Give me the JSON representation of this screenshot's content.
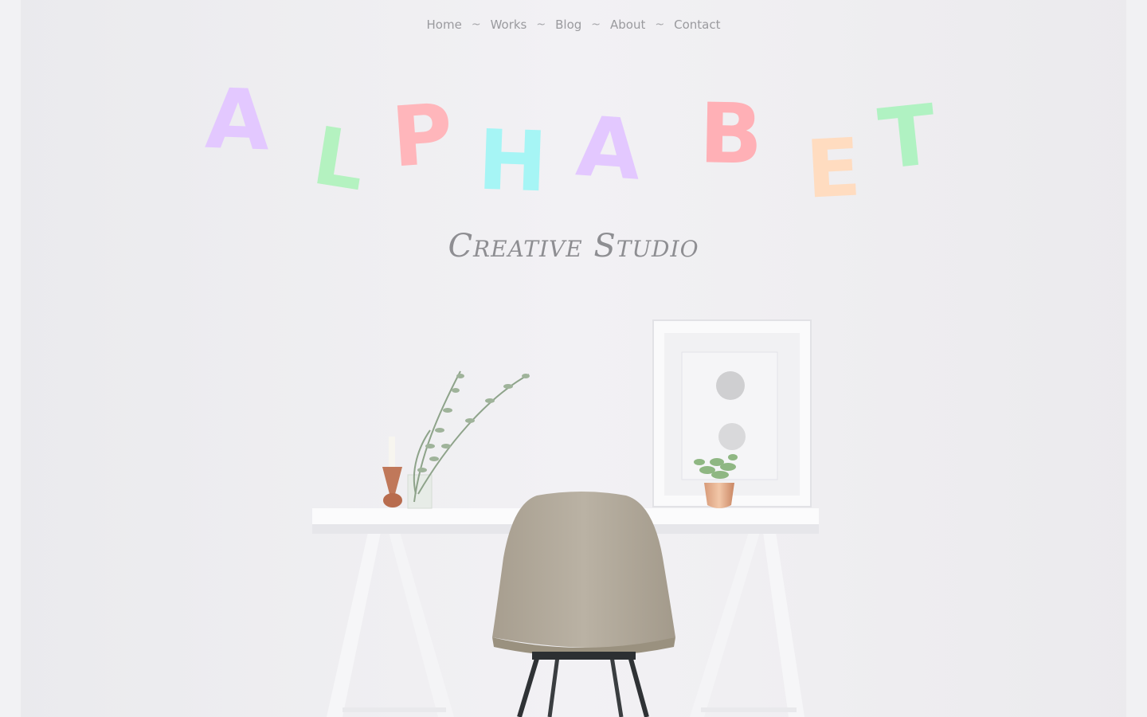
{
  "nav": {
    "items": [
      "Home",
      "Works",
      "Blog",
      "About",
      "Contact"
    ],
    "separator": "~"
  },
  "hero": {
    "letters": [
      {
        "char": "A",
        "color": "#e3c8ff"
      },
      {
        "char": "L",
        "color": "#b4f2c0"
      },
      {
        "char": "P",
        "color": "#ffb6bb"
      },
      {
        "char": "H",
        "color": "#a6f5f5"
      },
      {
        "char": "A",
        "color": "#e3c8ff"
      },
      {
        "char": "B",
        "color": "#ffb0b6"
      },
      {
        "char": "E",
        "color": "#ffdcc0"
      },
      {
        "char": "T",
        "color": "#b0f2c2"
      }
    ],
    "subtitle": "Creative Studio"
  },
  "colors": {
    "background": "#efeef1",
    "nav_text": "#9a9a9e",
    "chair": "#b4ab9c"
  }
}
